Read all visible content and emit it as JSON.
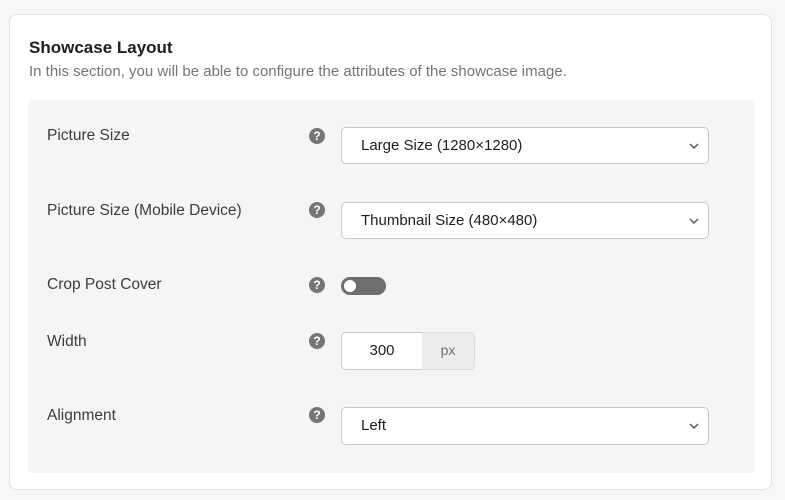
{
  "section": {
    "title": "Showcase Layout",
    "description": "In this section, you will be able to configure the attributes of the showcase image."
  },
  "fields": {
    "picture_size": {
      "label": "Picture Size",
      "value": "Large Size (1280×1280)",
      "help_icon": "question-circle-icon"
    },
    "picture_size_mobile": {
      "label": "Picture Size (Mobile Device)",
      "value": "Thumbnail Size (480×480)",
      "help_icon": "question-circle-icon"
    },
    "crop_post_cover": {
      "label": "Crop Post Cover",
      "enabled": false,
      "help_icon": "question-circle-icon"
    },
    "width": {
      "label": "Width",
      "value": "300",
      "unit": "px",
      "help_icon": "question-circle-icon"
    },
    "alignment": {
      "label": "Alignment",
      "value": "Left",
      "help_icon": "question-circle-icon"
    }
  },
  "colors": {
    "toggle_off": "#6e6e6e",
    "help_icon": "#767676",
    "panel_bg": "#f5f5f5"
  }
}
